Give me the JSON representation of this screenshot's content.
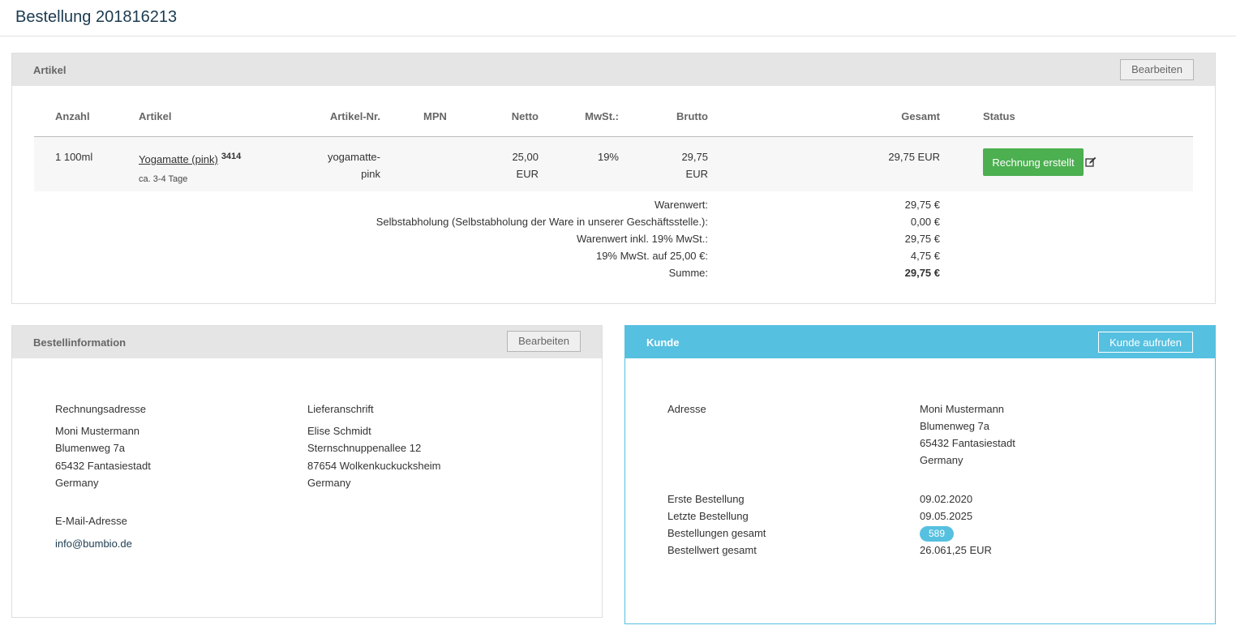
{
  "page": {
    "title": "Bestellung 201816213"
  },
  "articles": {
    "title": "Artikel",
    "edit_label": "Bearbeiten",
    "columns": {
      "qty": "Anzahl",
      "article": "Artikel",
      "article_no": "Artikel-Nr.",
      "mpn": "MPN",
      "net": "Netto",
      "vat": "MwSt.:",
      "gross": "Brutto",
      "total": "Gesamt",
      "status": "Status"
    },
    "row": {
      "qty": "1 100ml",
      "name": "Yogamatte (pink)",
      "id": "3414",
      "delivery": "ca. 3-4 Tage",
      "article_no_1": "yogamatte-",
      "article_no_2": "pink",
      "net_1": "25,00",
      "net_2": "EUR",
      "vat": "19%",
      "gross_1": "29,75",
      "gross_2": "EUR",
      "total": "29,75 EUR",
      "status_label": "Rechnung erstellt",
      "status_color": "#4caf50"
    },
    "summary": [
      {
        "label": "Warenwert:",
        "value": "29,75 €"
      },
      {
        "label": "Selbstabholung (Selbstabholung der Ware in unserer Geschäftsstelle.):",
        "value": "0,00 €"
      },
      {
        "label": "Warenwert inkl. 19% MwSt.:",
        "value": "29,75 €"
      },
      {
        "label": "19% MwSt. auf 25,00 €:",
        "value": "4,75 €"
      },
      {
        "label": "Summe:",
        "value": "29,75 €"
      }
    ]
  },
  "order_info": {
    "title": "Bestellinformation",
    "edit_label": "Bearbeiten",
    "billing": {
      "title": "Rechnungsadresse",
      "lines": [
        "Moni Mustermann",
        "Blumenweg 7a",
        "65432 Fantasiestadt",
        "Germany"
      ]
    },
    "shipping": {
      "title": "Lieferanschrift",
      "lines": [
        "Elise Schmidt",
        "Sternschnuppenallee 12",
        "87654 Wolkenkuckucksheim",
        "Germany"
      ]
    },
    "email_title": "E-Mail-Adresse",
    "email": "info@bumbio.de"
  },
  "customer": {
    "title": "Kunde",
    "open_label": "Kunde aufrufen",
    "accent": "#56c0e0",
    "address_label": "Adresse",
    "address_lines": [
      "Moni Mustermann",
      "Blumenweg 7a",
      "65432 Fantasiestadt",
      "Germany"
    ],
    "first_order_label": "Erste Bestellung",
    "first_order": "09.02.2020",
    "last_order_label": "Letzte Bestellung",
    "last_order": "09.05.2025",
    "orders_total_label": "Bestellungen gesamt",
    "orders_total": "589",
    "value_total_label": "Bestellwert gesamt",
    "value_total": "26.061,25 EUR"
  },
  "icons": {
    "status_edit": "edit-icon"
  }
}
